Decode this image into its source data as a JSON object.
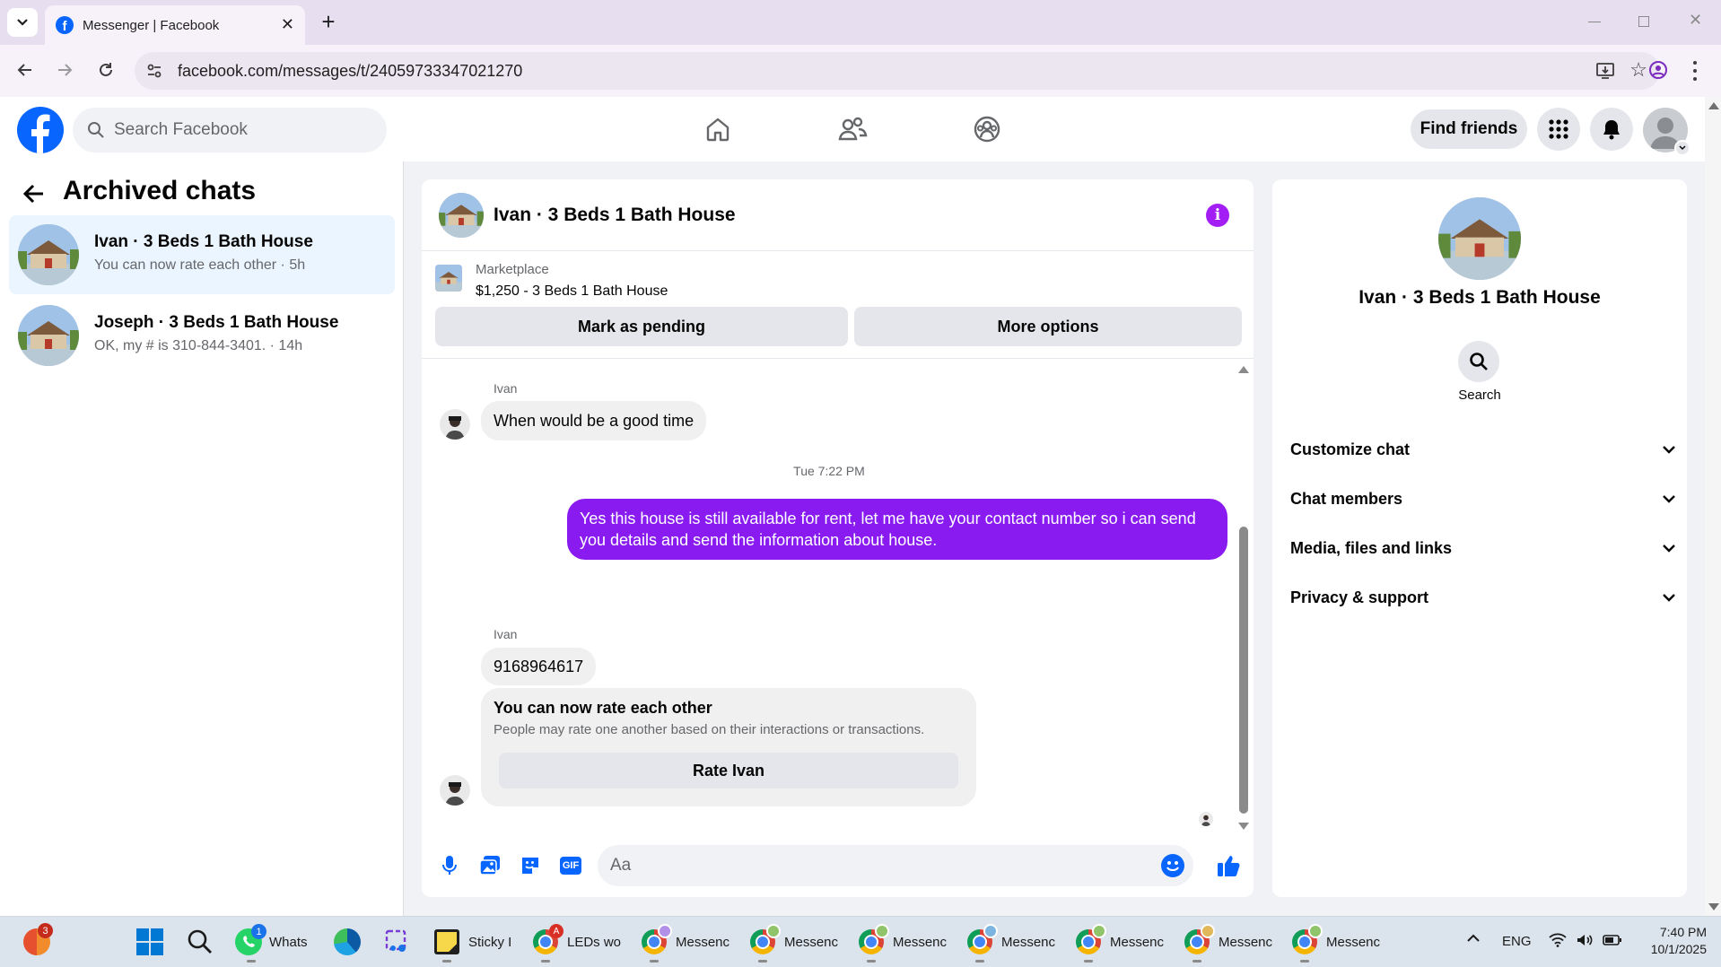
{
  "browser": {
    "tab_title": "Messenger | Facebook",
    "url": "facebook.com/messages/t/24059733347021270"
  },
  "header": {
    "search_placeholder": "Search Facebook",
    "find_friends": "Find friends"
  },
  "left": {
    "title": "Archived chats",
    "chats": [
      {
        "name": "Ivan · 3 Beds 1 Bath House",
        "preview": "You can now rate each other · 5h"
      },
      {
        "name": "Joseph · 3 Beds 1 Bath House",
        "preview": "OK, my # is 310-844-3401. · 14h"
      }
    ]
  },
  "chat": {
    "title": "Ivan · 3 Beds 1 Bath House",
    "marketplace_label": "Marketplace",
    "listing": "$1,250 - 3 Beds 1 Bath House",
    "mark_pending": "Mark as pending",
    "more_options": "More options",
    "messages": {
      "sender1": "Ivan",
      "msg1": "When would be a good time",
      "timestamp": "Tue 7:22 PM",
      "outgoing": "Yes this house is still available for rent, let me have your contact number so i can send you details and send the information about house.",
      "sender2": "Ivan",
      "msg2": "9168964617",
      "rate_title": "You can now rate each other",
      "rate_sub": "People may rate one another based on their interactions or transactions.",
      "rate_button": "Rate Ivan"
    },
    "composer_placeholder": "Aa"
  },
  "info": {
    "name": "Ivan · 3 Beds 1 Bath House",
    "search_label": "Search",
    "sections": [
      "Customize chat",
      "Chat members",
      "Media, files and links",
      "Privacy & support"
    ]
  },
  "taskbar": {
    "apps": [
      {
        "label": "Whats",
        "badge": "1"
      },
      {
        "label": "Sticky I"
      },
      {
        "label": "LEDs wo",
        "badge": "A"
      },
      {
        "label": "Messenc"
      },
      {
        "label": "Messenc"
      },
      {
        "label": "Messenc"
      },
      {
        "label": "Messenc"
      },
      {
        "label": "Messenc"
      },
      {
        "label": "Messenc"
      },
      {
        "label": "Messenc"
      }
    ],
    "start_badge": "3",
    "lang": "ENG",
    "time": "7:40 PM",
    "date": "10/1/2025"
  },
  "colors": {
    "accent": "#0866ff",
    "outgoing_bubble": "#8a1bf0",
    "info_icon": "#a21ef5"
  }
}
